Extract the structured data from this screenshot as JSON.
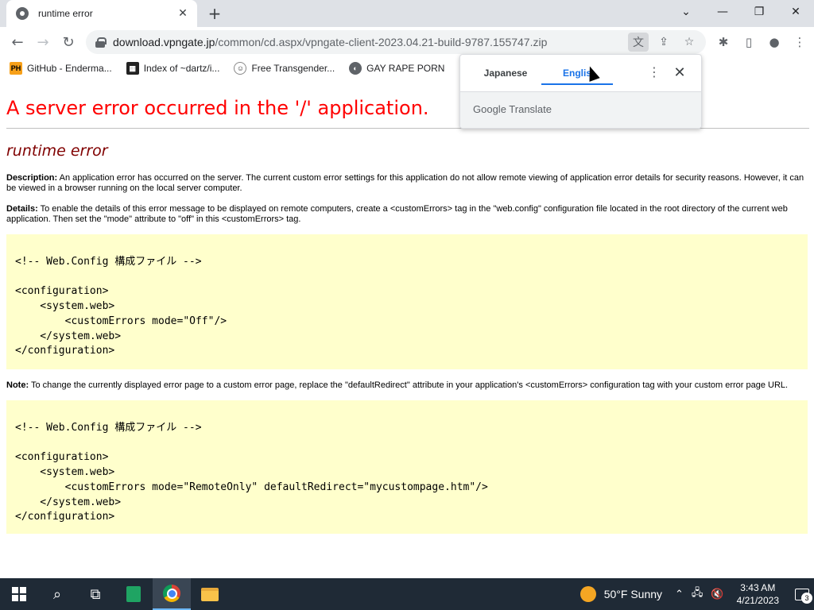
{
  "browser": {
    "tab_title": "runtime error",
    "url_host": "download.vpngate.jp",
    "url_path": "/common/cd.aspx/vpngate-client-2023.04.21-build-9787.155747.zip",
    "bookmarks": [
      {
        "label": "GitHub - Enderma...",
        "icon": "PH"
      },
      {
        "label": "Index of ~dartz/i...",
        "icon": "index-icon"
      },
      {
        "label": "Free Transgender...",
        "icon": "mask-icon"
      },
      {
        "label": "GAY RAPE PORN",
        "icon": "globe-icon"
      }
    ]
  },
  "translate_popup": {
    "tabs": [
      {
        "label": "Japanese",
        "selected": false
      },
      {
        "label": "Englis",
        "selected": true
      }
    ],
    "brand": "Google Translate"
  },
  "page": {
    "title": "A server error occurred in the '/' application.",
    "subtitle": "runtime error",
    "description_label": "Description:",
    "description_text": " An application error has occurred on the server. The current custom error settings for this application do not allow remote viewing of application error details for security reasons. However, it can be viewed in a browser running on the local server computer.",
    "details_label": "Details:",
    "details_text": " To enable the details of this error message to be displayed on remote computers, create a <customErrors> tag in the \"web.config\" configuration file located in the root directory of the current web application. Then set the \"mode\" attribute to \"off\" in this <customErrors> tag.",
    "code1": "<!-- Web.Config 構成ファイル -->\n\n<configuration>\n    <system.web>\n        <customErrors mode=\"Off\"/>\n    </system.web>\n</configuration>",
    "note_label": "Note:",
    "note_text": " To change the currently displayed error page to a custom error page, replace the \"defaultRedirect\" attribute in your application's <customErrors> configuration tag with your custom error page URL.",
    "code2": "<!-- Web.Config 構成ファイル -->\n\n<configuration>\n    <system.web>\n        <customErrors mode=\"RemoteOnly\" defaultRedirect=\"mycustompage.htm\"/>\n    </system.web>\n</configuration>"
  },
  "taskbar": {
    "weather": "50°F  Sunny",
    "time": "3:43 AM",
    "date": "4/21/2023",
    "notifications": "3"
  },
  "colors": {
    "title_red": "#ff0000",
    "subtitle_maroon": "#800000",
    "code_bg": "#ffffcc",
    "taskbar_bg": "#1f2a36",
    "accent_blue": "#1a73e8"
  }
}
